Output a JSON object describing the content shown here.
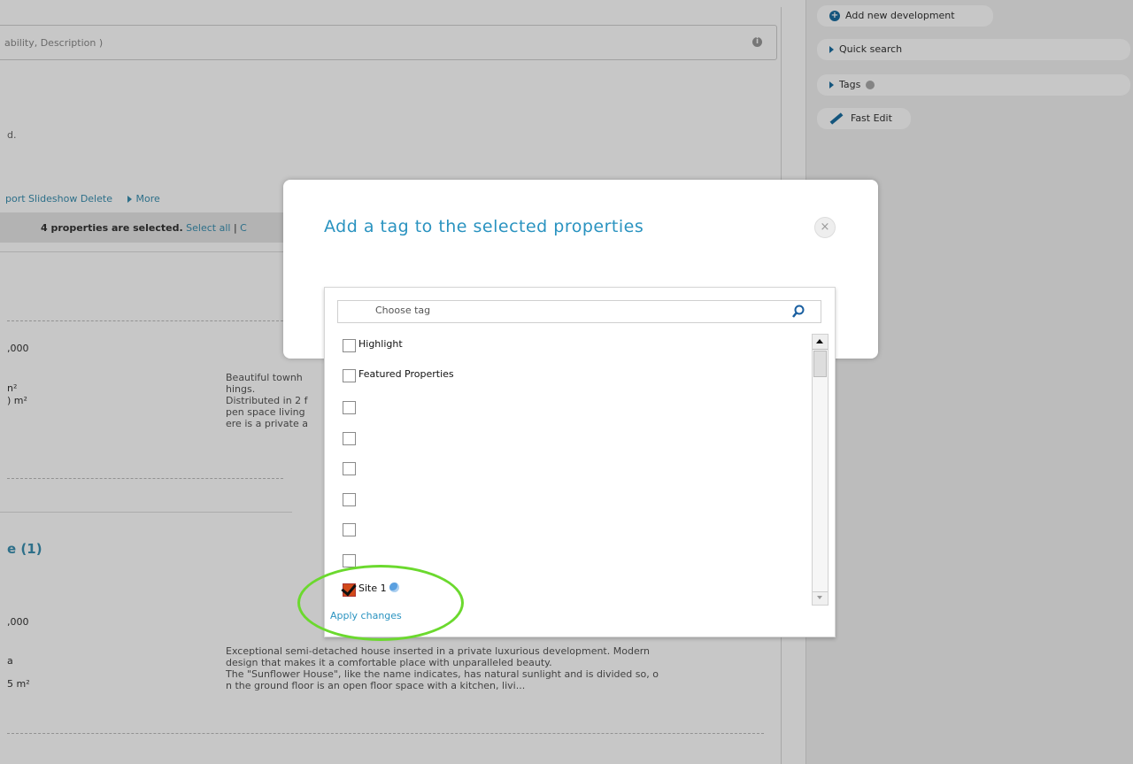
{
  "background": {
    "search_placeholder": "ability, Description )",
    "search_info_icon": "i",
    "notice_fragment": "d.",
    "actions": {
      "export_slideshow_delete": "port Slideshow Delete",
      "more": "More"
    },
    "selection_bar": {
      "text": "4 properties are selected.",
      "select_all": "Select all",
      "separator": "|",
      "next_fragment": "C"
    },
    "listing1": {
      "price": ",000",
      "area1": "n²",
      "area2": ") m²",
      "desc_lines": [
        "Beautiful townh",
        "hings.",
        "Distributed in 2 f",
        "pen space living",
        "ere is a private a"
      ]
    },
    "section_title": "e (1)",
    "listing2": {
      "price": ",000",
      "area1": "a",
      "area2": "5 m²",
      "desc_lines": [
        "Exceptional semi-detached house inserted in a private luxurious development. Modern",
        "design that makes it a comfortable place with unparalleled beauty.",
        "The \"Sunflower House\", like the name indicates, has natural sunlight and is divided so, o",
        "n the ground floor is an open floor space with a kitchen, livi..."
      ]
    }
  },
  "sidebar": {
    "add_new_development": "Add new development",
    "quick_search": "Quick search",
    "tags": "Tags",
    "fast_edit": "Fast Edit"
  },
  "modal": {
    "title": "Add a tag to the selected properties",
    "close_symbol": "×"
  },
  "tag_panel": {
    "search_placeholder": "Choose tag",
    "search_icon": "magnifier-icon",
    "tags": [
      {
        "label": "Highlight",
        "checked": false
      },
      {
        "label": "Featured Properties",
        "checked": false
      },
      {
        "label": "",
        "checked": false
      },
      {
        "label": "",
        "checked": false
      },
      {
        "label": "",
        "checked": false
      },
      {
        "label": "",
        "checked": false
      },
      {
        "label": "",
        "checked": false
      },
      {
        "label": "",
        "checked": false
      },
      {
        "label": "Site 1",
        "checked": true,
        "icon": "globe-icon"
      }
    ],
    "apply_label": "Apply changes"
  },
  "colors": {
    "accent": "#2a93c0",
    "check": "#d24a1a",
    "highlight_ring": "#6bd92e"
  }
}
